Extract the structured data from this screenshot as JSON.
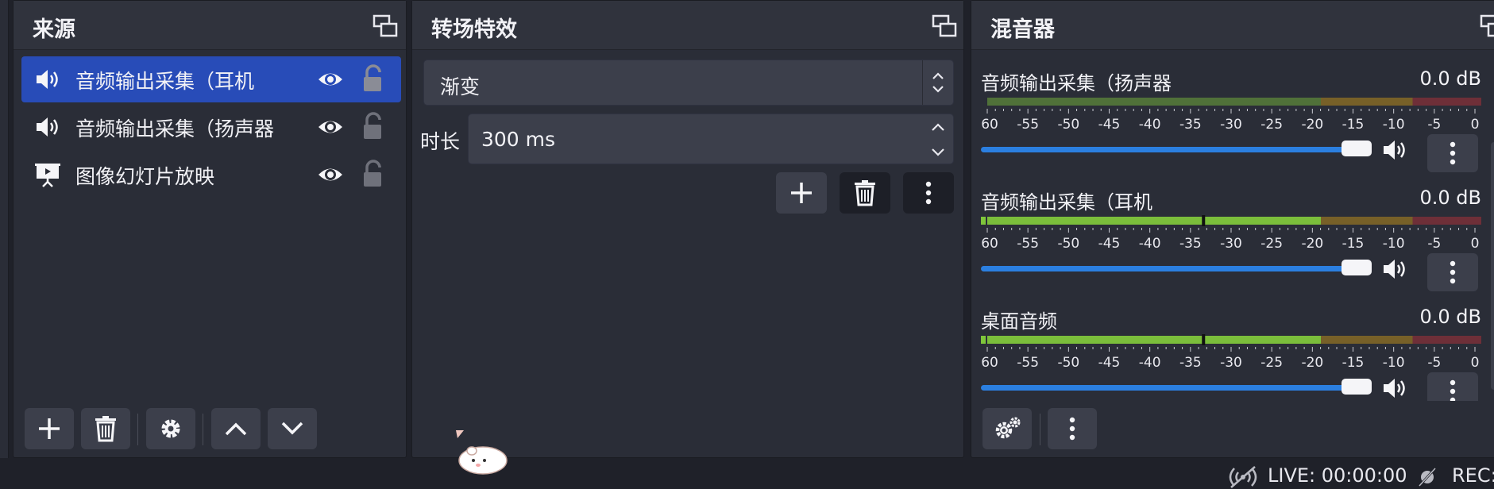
{
  "sources": {
    "title": "来源",
    "items": [
      {
        "label": "音频输出采集（耳机",
        "icon": "speaker-icon",
        "selected": true
      },
      {
        "label": "音频输出采集（扬声器",
        "icon": "speaker-icon",
        "selected": false
      },
      {
        "label": "图像幻灯片放映",
        "icon": "slideshow-icon",
        "selected": false
      }
    ],
    "toolbar": [
      "add",
      "remove",
      "properties",
      "move-up",
      "move-down"
    ]
  },
  "transitions": {
    "title": "转场特效",
    "selected_transition": "渐变",
    "duration_label": "时长",
    "duration_value": "300 ms"
  },
  "mixer": {
    "title": "混音器",
    "ticks": [
      "-60",
      "-55",
      "-50",
      "-45",
      "-40",
      "-35",
      "-30",
      "-25",
      "-20",
      "-15",
      "-10",
      "-5",
      "0"
    ],
    "channels": [
      {
        "name": "音频输出采集（扬声器",
        "db": "0.0 dB",
        "volume_fraction": 1.0,
        "active": false
      },
      {
        "name": "音频输出采集（耳机",
        "db": "0.0 dB",
        "volume_fraction": 1.0,
        "active": true
      },
      {
        "name": "桌面音频",
        "db": "0.0 dB",
        "volume_fraction": 1.0,
        "active": true
      }
    ]
  },
  "status": {
    "live": "LIVE: 00:00:00",
    "rec": "REC:"
  },
  "colors": {
    "accent": "#284cb8",
    "fader": "#2b7fe0",
    "meter_green": "#7fc63b",
    "meter_yellow": "#d4a017",
    "meter_red": "#c0323a"
  }
}
